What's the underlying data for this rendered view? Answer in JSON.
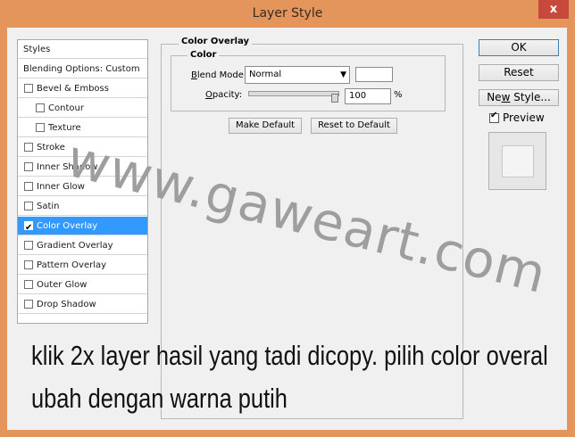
{
  "window": {
    "title": "Layer Style",
    "close_glyph": "x"
  },
  "styles_list": {
    "header": "Styles",
    "blending": "Blending Options: Custom",
    "items": [
      {
        "label": "Bevel & Emboss",
        "checked": false,
        "indent": false
      },
      {
        "label": "Contour",
        "checked": false,
        "indent": true
      },
      {
        "label": "Texture",
        "checked": false,
        "indent": true
      },
      {
        "label": "Stroke",
        "checked": false,
        "indent": false
      },
      {
        "label": "Inner Shadow",
        "checked": false,
        "indent": false
      },
      {
        "label": "Inner Glow",
        "checked": false,
        "indent": false
      },
      {
        "label": "Satin",
        "checked": false,
        "indent": false
      },
      {
        "label": "Color Overlay",
        "checked": true,
        "indent": false,
        "selected": true
      },
      {
        "label": "Gradient Overlay",
        "checked": false,
        "indent": false
      },
      {
        "label": "Pattern Overlay",
        "checked": false,
        "indent": false
      },
      {
        "label": "Outer Glow",
        "checked": false,
        "indent": false
      },
      {
        "label": "Drop Shadow",
        "checked": false,
        "indent": false
      }
    ]
  },
  "color_overlay": {
    "group_title": "Color Overlay",
    "subgroup_title": "Color",
    "blend_mode_label": "Blend Mode:",
    "blend_mode_value": "Normal",
    "overlay_color": "#ffffff",
    "opacity_label": "Opacity:",
    "opacity_value": "100",
    "opacity_unit": "%",
    "opacity_fraction": 1.0,
    "make_default": "Make Default",
    "reset_default": "Reset to Default"
  },
  "actions": {
    "ok": "OK",
    "reset": "Reset",
    "new_style": "New Style...",
    "preview_label": "Preview",
    "preview_checked": true
  },
  "watermark": "www.gaweart.com",
  "annotation": {
    "line1": "klik 2x layer hasil yang tadi dicopy. pilih color overal",
    "line2": "ubah dengan warna putih"
  },
  "colors": {
    "titlebar": "#e3955c",
    "selection": "#3399ff",
    "close": "#c7493c"
  }
}
